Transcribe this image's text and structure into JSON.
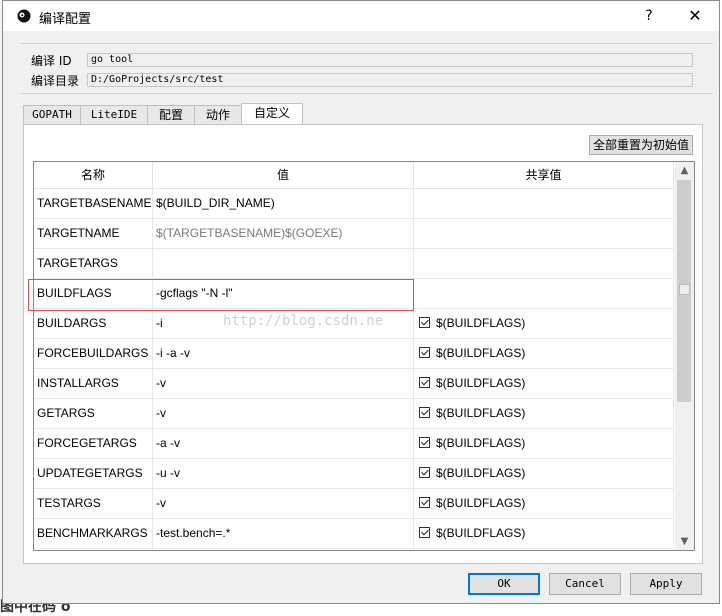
{
  "window": {
    "title": "编译配置",
    "help": "?",
    "close": "✕"
  },
  "fields": [
    {
      "label": "编译 ID",
      "value": "go tool"
    },
    {
      "label": "编译目录",
      "value": "D:/GoProjects/src/test"
    }
  ],
  "tabs": [
    {
      "label": "GOPATH",
      "active": false
    },
    {
      "label": "LiteIDE",
      "active": false
    },
    {
      "label": "配置",
      "active": false
    },
    {
      "label": "动作",
      "active": false
    },
    {
      "label": "自定义",
      "active": true
    }
  ],
  "reset_button": "全部重置为初始值",
  "table": {
    "headers": [
      "名称",
      "值",
      "共享值"
    ],
    "rows": [
      {
        "name": "TARGETBASENAME",
        "value": "$(BUILD_DIR_NAME)",
        "shared": "",
        "checked": false,
        "muted": false
      },
      {
        "name": "TARGETNAME",
        "value": "$(TARGETBASENAME)$(GOEXE)",
        "shared": "",
        "checked": false,
        "muted": true
      },
      {
        "name": "TARGETARGS",
        "value": "",
        "shared": "",
        "checked": false,
        "muted": false
      },
      {
        "name": "BUILDFLAGS",
        "value": "-gcflags \"-N -l\"",
        "shared": "",
        "checked": false,
        "muted": false
      },
      {
        "name": "BUILDARGS",
        "value": "-i",
        "shared": "$(BUILDFLAGS)",
        "checked": true,
        "muted": false
      },
      {
        "name": "FORCEBUILDARGS",
        "value": "-i -a -v",
        "shared": "$(BUILDFLAGS)",
        "checked": true,
        "muted": false
      },
      {
        "name": "INSTALLARGS",
        "value": "-v",
        "shared": "$(BUILDFLAGS)",
        "checked": true,
        "muted": false
      },
      {
        "name": "GETARGS",
        "value": "-v",
        "shared": "$(BUILDFLAGS)",
        "checked": true,
        "muted": false
      },
      {
        "name": "FORCEGETARGS",
        "value": "-a -v",
        "shared": "$(BUILDFLAGS)",
        "checked": true,
        "muted": false
      },
      {
        "name": "UPDATEGETARGS",
        "value": "-u -v",
        "shared": "$(BUILDFLAGS)",
        "checked": true,
        "muted": false
      },
      {
        "name": "TESTARGS",
        "value": "-v",
        "shared": "$(BUILDFLAGS)",
        "checked": true,
        "muted": false
      },
      {
        "name": "BENCHMARKARGS",
        "value": "-test.bench=.*",
        "shared": "$(BUILDFLAGS)",
        "checked": true,
        "muted": false
      }
    ]
  },
  "watermark": "http://blog.csdn.ne",
  "buttons": {
    "ok": "OK",
    "cancel": "Cancel",
    "apply": "Apply"
  },
  "background": {
    "bottom_text": "图中在码 o"
  },
  "colors": {
    "highlight": "#d9534f",
    "default_button_border": "#0078d7"
  }
}
